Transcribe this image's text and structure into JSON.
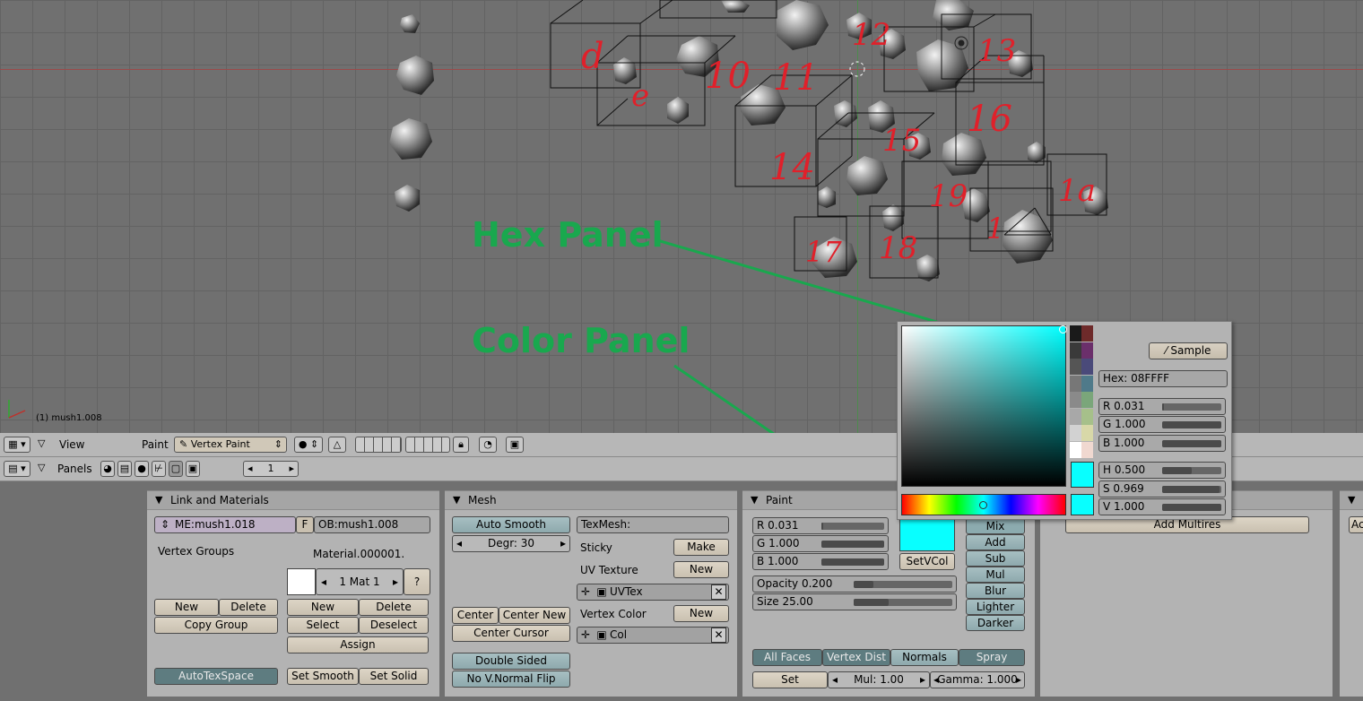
{
  "viewport": {
    "object_label": "(1) mush1.008",
    "annotation_hex": "Hex Panel",
    "annotation_color": "Color Panel",
    "sketch_numbers": [
      "d",
      "e",
      "10",
      "11",
      "12",
      "13",
      "14",
      "15",
      "16",
      "17",
      "18",
      "19",
      "1a",
      "1"
    ]
  },
  "header1": {
    "view": "View",
    "paint": "Paint",
    "mode": "Vertex Paint"
  },
  "header2": {
    "panels": "Panels",
    "page_value": "1"
  },
  "colors": {
    "accent_green": "#19a84e",
    "paint_color": "#08ffff",
    "sketch_red": "#e0202a"
  },
  "link_materials": {
    "title": "Link and Materials",
    "mesh_name": "ME:mush1.018",
    "fake_btn": "F",
    "object_name": "OB:mush1.008",
    "vertex_groups": "Vertex Groups",
    "material_name": "Material.000001.",
    "mat_index": "1 Mat 1",
    "question": "?",
    "vg_new": "New",
    "vg_delete": "Delete",
    "copy_group": "Copy Group",
    "mat_new": "New",
    "mat_delete": "Delete",
    "mat_select": "Select",
    "mat_deselect": "Deselect",
    "mat_assign": "Assign",
    "autotexspace": "AutoTexSpace",
    "set_smooth": "Set Smooth",
    "set_solid": "Set Solid"
  },
  "mesh": {
    "title": "Mesh",
    "auto_smooth": "Auto Smooth",
    "degr": "Degr: 30",
    "texmesh": "TexMesh:",
    "sticky": "Sticky",
    "sticky_btn": "Make",
    "uv_texture": "UV Texture",
    "uv_new": "New",
    "uvtex_name": "UVTex",
    "vertex_color": "Vertex Color",
    "vc_new": "New",
    "col_name": "Col",
    "center": "Center",
    "center_new": "Center New",
    "center_cursor": "Center Cursor",
    "double_sided": "Double Sided",
    "no_vnormal_flip": "No V.Normal Flip"
  },
  "paint": {
    "title": "Paint",
    "r": "R 0.031",
    "r_val": 0.031,
    "g": "G 1.000",
    "g_val": 1.0,
    "b": "B 1.000",
    "b_val": 1.0,
    "opacity": "Opacity 0.200",
    "opacity_val": 0.2,
    "size": "Size 25.00",
    "size_val": 0.35,
    "setvcol": "SetVCol",
    "modes": [
      "Mix",
      "Add",
      "Sub",
      "Mul",
      "Blur",
      "Lighter",
      "Darker"
    ],
    "all_faces": "All Faces",
    "vertex_dist": "Vertex Dist",
    "normals": "Normals",
    "spray": "Spray",
    "set": "Set",
    "mul": "Mul: 1.00",
    "gamma": "Gamma: 1.000"
  },
  "multires": {
    "add_multires": "Add Multires",
    "partial": "Ac"
  },
  "color_picker": {
    "sample": "Sample",
    "hex": "Hex: 08FFFF",
    "r": "R 0.031",
    "r_val": 0.031,
    "g": "G 1.000",
    "g_val": 1.0,
    "b": "B 1.000",
    "b_val": 1.0,
    "h": "H 0.500",
    "h_val": 0.5,
    "s": "S 0.969",
    "s_val": 0.969,
    "v": "V 1.000",
    "v_val": 1.0,
    "palette": [
      "#1a1a1a",
      "#6e2a2a",
      "#3a3a3a",
      "#6b2f6b",
      "#555555",
      "#4a4a7a",
      "#777777",
      "#4f7a8a",
      "#8a8a8a",
      "#7aa67a",
      "#a8a8a8",
      "#a6c08a",
      "#d2d2d2",
      "#d8d8a8",
      "#ffffff",
      "#f0d8d0"
    ]
  }
}
